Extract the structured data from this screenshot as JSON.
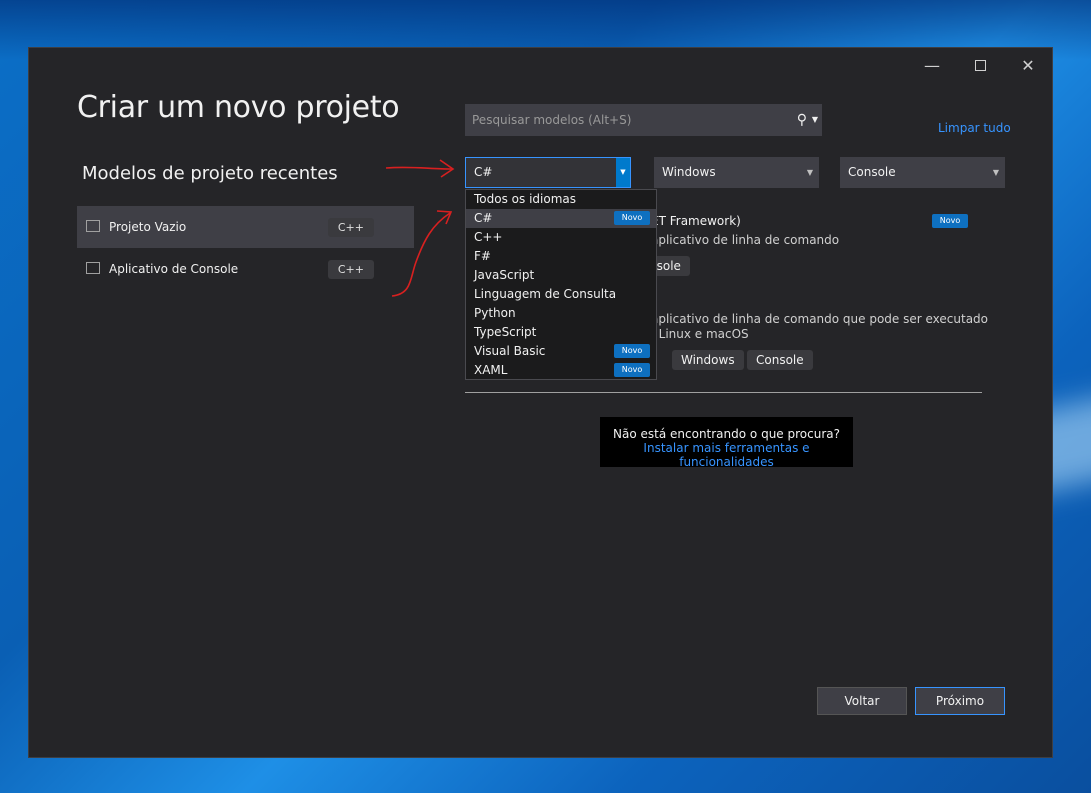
{
  "window": {
    "title": "Criar um novo projeto",
    "controls": {
      "minimize": "—",
      "close": "✕"
    }
  },
  "recent": {
    "title": "Modelos de projeto recentes",
    "items": [
      {
        "label": "Projeto Vazio",
        "tag": "C++",
        "selected": true
      },
      {
        "label": "Aplicativo de Console",
        "tag": "C++",
        "selected": false
      }
    ]
  },
  "search": {
    "placeholder": "Pesquisar modelos (Alt+S)"
  },
  "clear_all": "Limpar tudo",
  "filters": {
    "language": "C#",
    "platform": "Windows",
    "project_type": "Console"
  },
  "language_dropdown": {
    "items": [
      {
        "label": "Todos os idiomas",
        "badge": ""
      },
      {
        "label": "C#",
        "badge": "Novo"
      },
      {
        "label": "C++",
        "badge": ""
      },
      {
        "label": "F#",
        "badge": ""
      },
      {
        "label": "JavaScript",
        "badge": ""
      },
      {
        "label": "Linguagem de Consulta",
        "badge": ""
      },
      {
        "label": "Python",
        "badge": ""
      },
      {
        "label": "TypeScript",
        "badge": ""
      },
      {
        "label": "Visual Basic",
        "badge": "Novo"
      },
      {
        "label": "XAML",
        "badge": "Novo"
      }
    ]
  },
  "templates": {
    "first": {
      "title_partial": "ET Framework)",
      "badge": "Novo",
      "desc_partial": "aplicativo de linha de comando",
      "tag_partial": "nsole"
    },
    "second": {
      "desc_line1_partial": "aplicativo de linha de comando que pode ser executado",
      "desc_line2_partial": ", Linux e macOS",
      "tags": [
        "Windows",
        "Console"
      ]
    }
  },
  "not_found": {
    "question": "Não está encontrando o que procura?",
    "link": "Instalar mais ferramentas e funcionalidades"
  },
  "buttons": {
    "back": "Voltar",
    "next": "Próximo"
  },
  "colors": {
    "accent": "#3794ff",
    "badge": "#0e70c0",
    "annotation": "#d82020"
  }
}
